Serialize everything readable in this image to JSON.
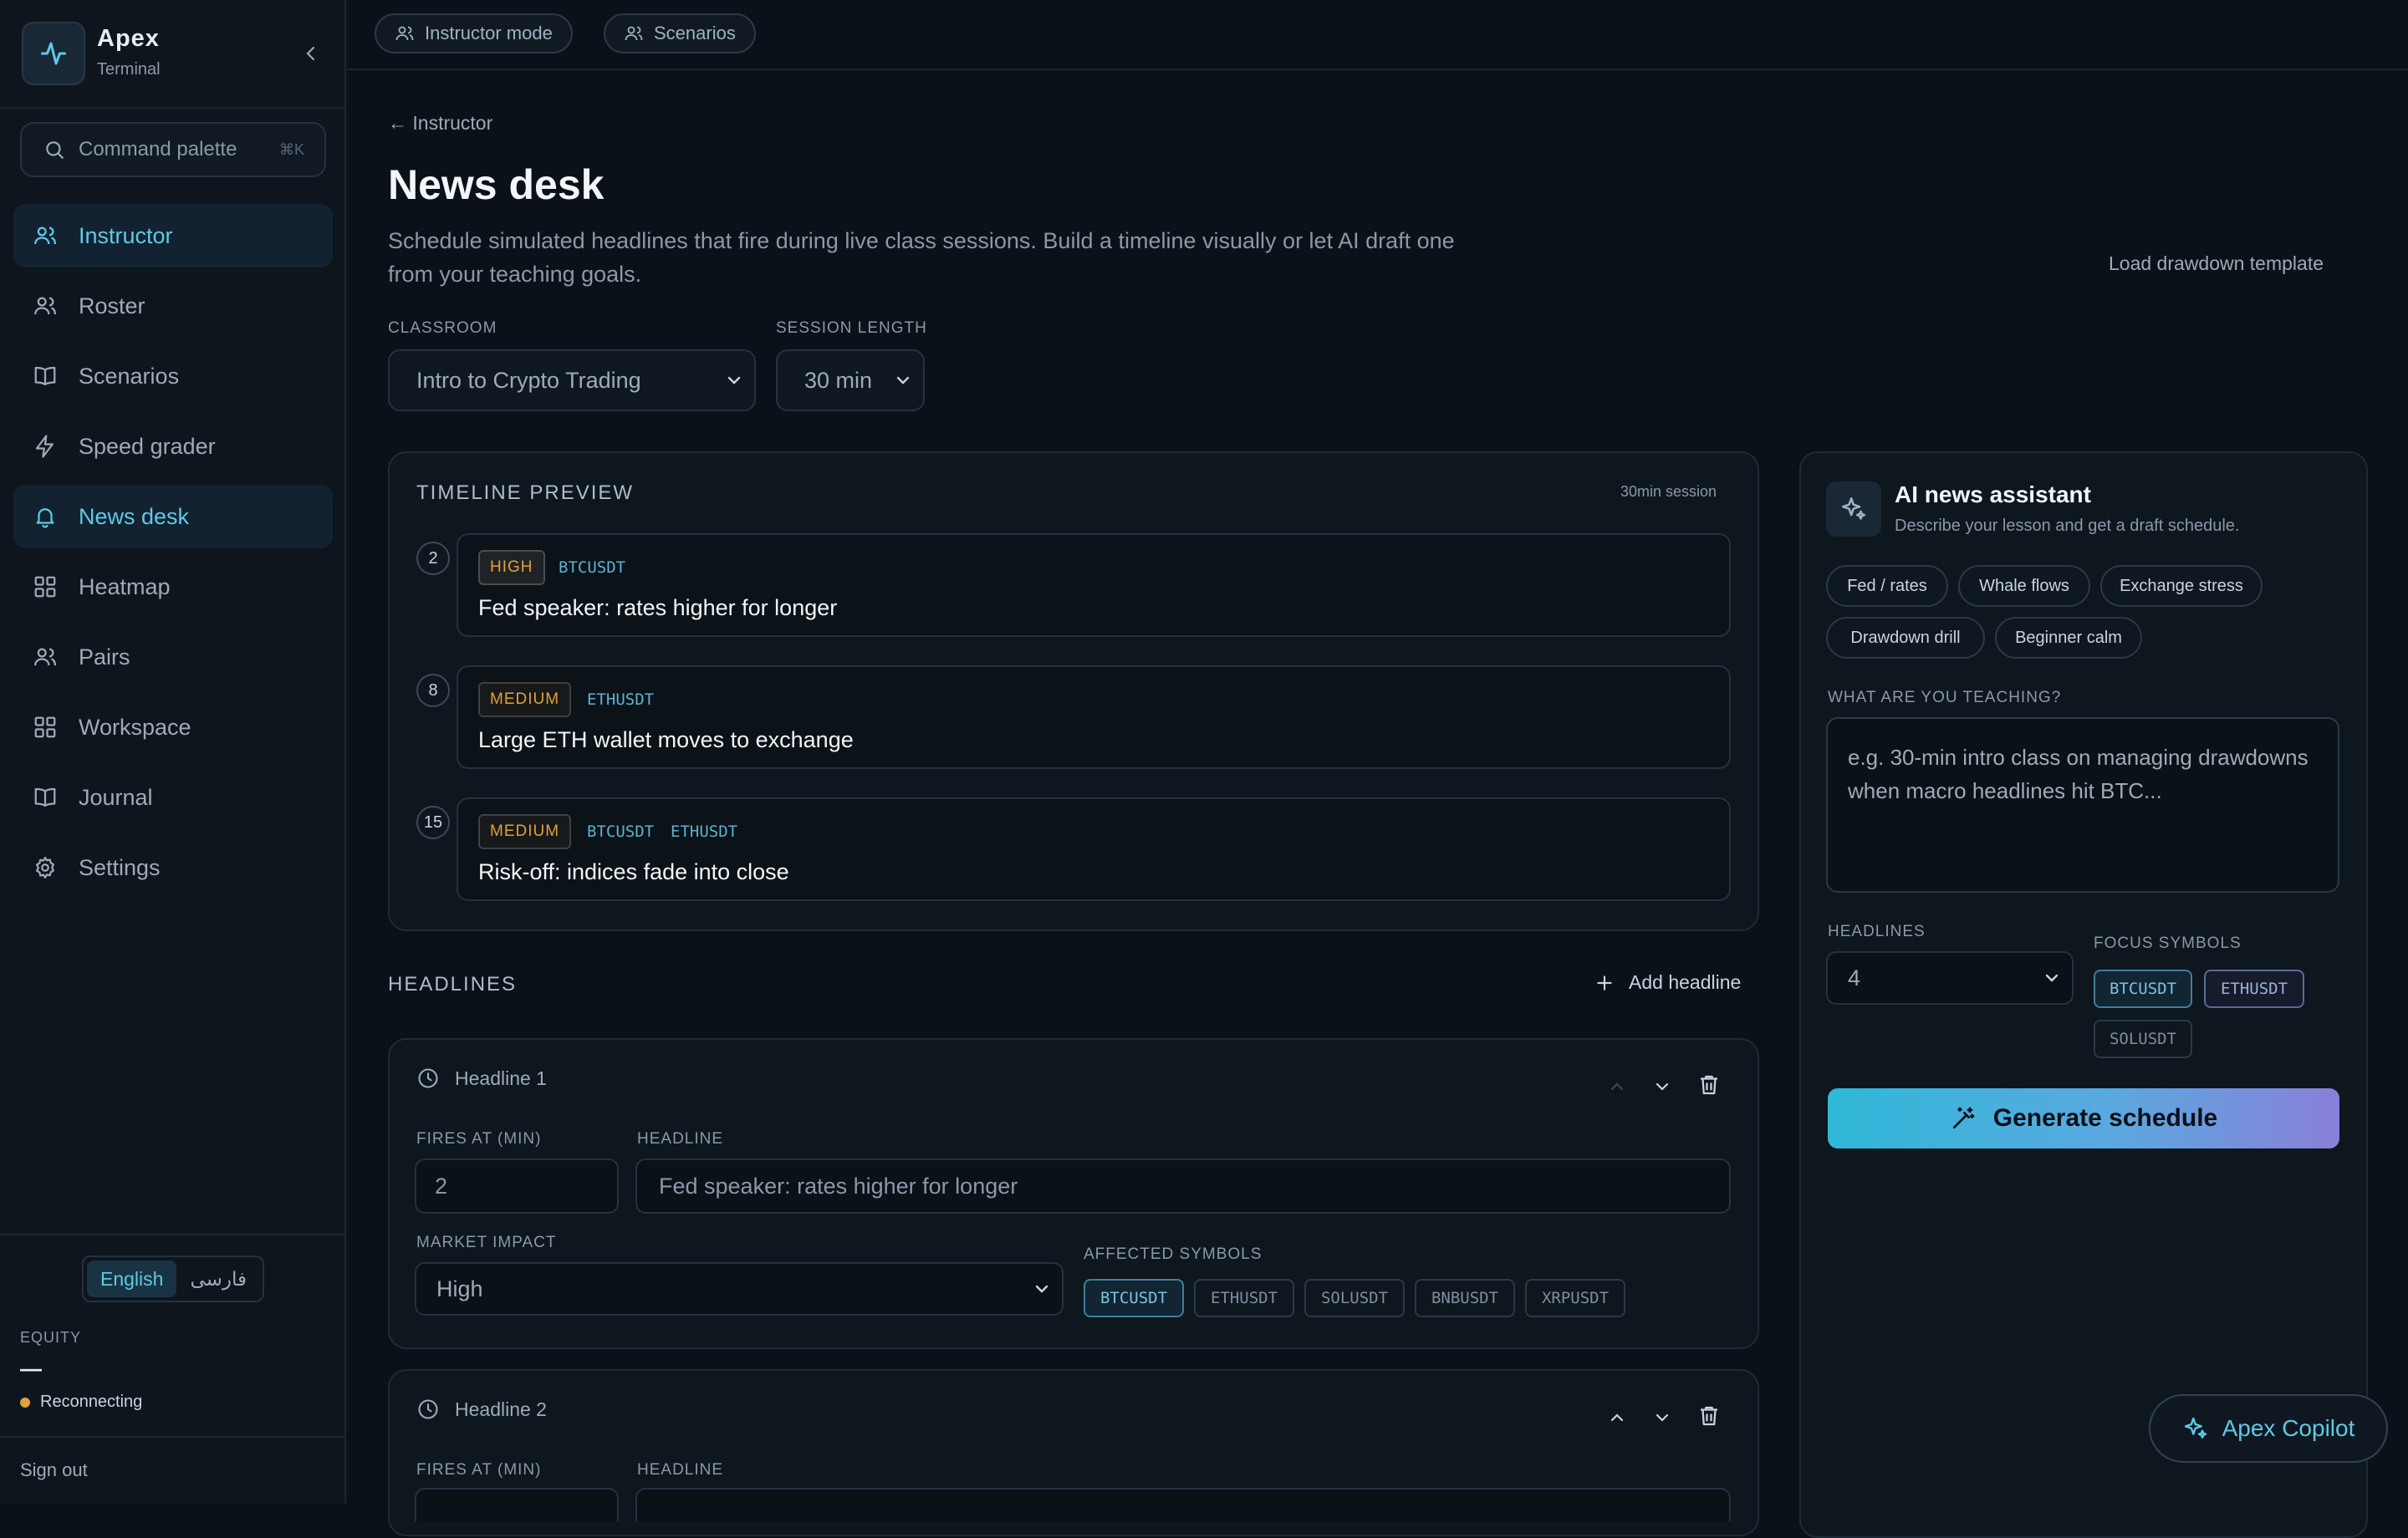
{
  "brand": {
    "name": "Apex",
    "subtitle": "Terminal"
  },
  "command_palette": {
    "label": "Command palette",
    "shortcut": "⌘K"
  },
  "nav": [
    {
      "label": "Instructor",
      "icon": "users-icon",
      "active": true
    },
    {
      "label": "Roster",
      "icon": "users-icon"
    },
    {
      "label": "Scenarios",
      "icon": "book-icon"
    },
    {
      "label": "Speed grader",
      "icon": "bolt-icon"
    },
    {
      "label": "News desk",
      "icon": "bell-icon",
      "active": true
    },
    {
      "label": "Heatmap",
      "icon": "grid-icon"
    },
    {
      "label": "Pairs",
      "icon": "users-icon"
    },
    {
      "label": "Workspace",
      "icon": "grid-icon"
    },
    {
      "label": "Journal",
      "icon": "book-icon"
    },
    {
      "label": "Settings",
      "icon": "gear-icon"
    }
  ],
  "language": {
    "english": "English",
    "farsi": "فارسی"
  },
  "equity": {
    "label": "EQUITY",
    "value": "—"
  },
  "connection": {
    "status": "Reconnecting",
    "color": "#e0a23a"
  },
  "signout": "Sign out",
  "topbar": {
    "instructor_mode": "Instructor mode",
    "scenarios": "Scenarios"
  },
  "page": {
    "back": "← Instructor",
    "title": "News desk",
    "subtitle": "Schedule simulated headlines that fire during live class sessions. Build a timeline visually or let AI draft one from your teaching goals.",
    "load_template": "Load drawdown template"
  },
  "classroom": {
    "label": "CLASSROOM",
    "value": "Intro to Crypto Trading"
  },
  "session_length": {
    "label": "SESSION LENGTH",
    "value": "30 min"
  },
  "timeline": {
    "title": "TIMELINE PREVIEW",
    "note": "30min session",
    "items": [
      {
        "minute": "2",
        "impact": "HIGH",
        "symbols": [
          "BTCUSDT"
        ],
        "text": "Fed speaker: rates higher for longer"
      },
      {
        "minute": "8",
        "impact": "MEDIUM",
        "symbols": [
          "ETHUSDT"
        ],
        "text": "Large ETH wallet moves to exchange"
      },
      {
        "minute": "15",
        "impact": "MEDIUM",
        "symbols": [
          "BTCUSDT",
          "ETHUSDT"
        ],
        "text": "Risk-off: indices fade into close"
      }
    ]
  },
  "headlines": {
    "title": "HEADLINES",
    "add_label": "Add headline",
    "fires_at_label": "FIRES AT (MIN)",
    "headline_label": "HEADLINE",
    "market_impact_label": "MARKET IMPACT",
    "affected_symbols_label": "AFFECTED SYMBOLS",
    "items": [
      {
        "title": "Headline 1",
        "fires_at": "2",
        "headline": "Fed speaker: rates higher for longer",
        "impact": "High",
        "symbols": [
          "BTCUSDT",
          "ETHUSDT",
          "SOLUSDT",
          "BNBUSDT",
          "XRPUSDT"
        ],
        "selected": [
          "BTCUSDT"
        ]
      },
      {
        "title": "Headline 2"
      }
    ]
  },
  "ai": {
    "title": "AI news assistant",
    "subtitle": "Describe your lesson and get a draft schedule.",
    "presets": [
      "Fed / rates",
      "Whale flows",
      "Exchange stress",
      "Drawdown drill",
      "Beginner calm"
    ],
    "teaching_label": "WHAT ARE YOU TEACHING?",
    "teaching_placeholder": "e.g. 30-min intro class on managing drawdowns when macro headlines hit BTC...",
    "headlines_label": "HEADLINES",
    "headlines_value": "4",
    "focus_label": "FOCUS SYMBOLS",
    "focus_symbols": [
      "BTCUSDT",
      "ETHUSDT",
      "SOLUSDT"
    ],
    "focus_selected": [
      "BTCUSDT",
      "ETHUSDT"
    ],
    "generate_label": "Generate schedule"
  },
  "copilot": {
    "label": "Apex Copilot"
  },
  "colors": {
    "accent": "#5fc9e6",
    "impact": "#e0a23a",
    "background": "#0b1118"
  }
}
